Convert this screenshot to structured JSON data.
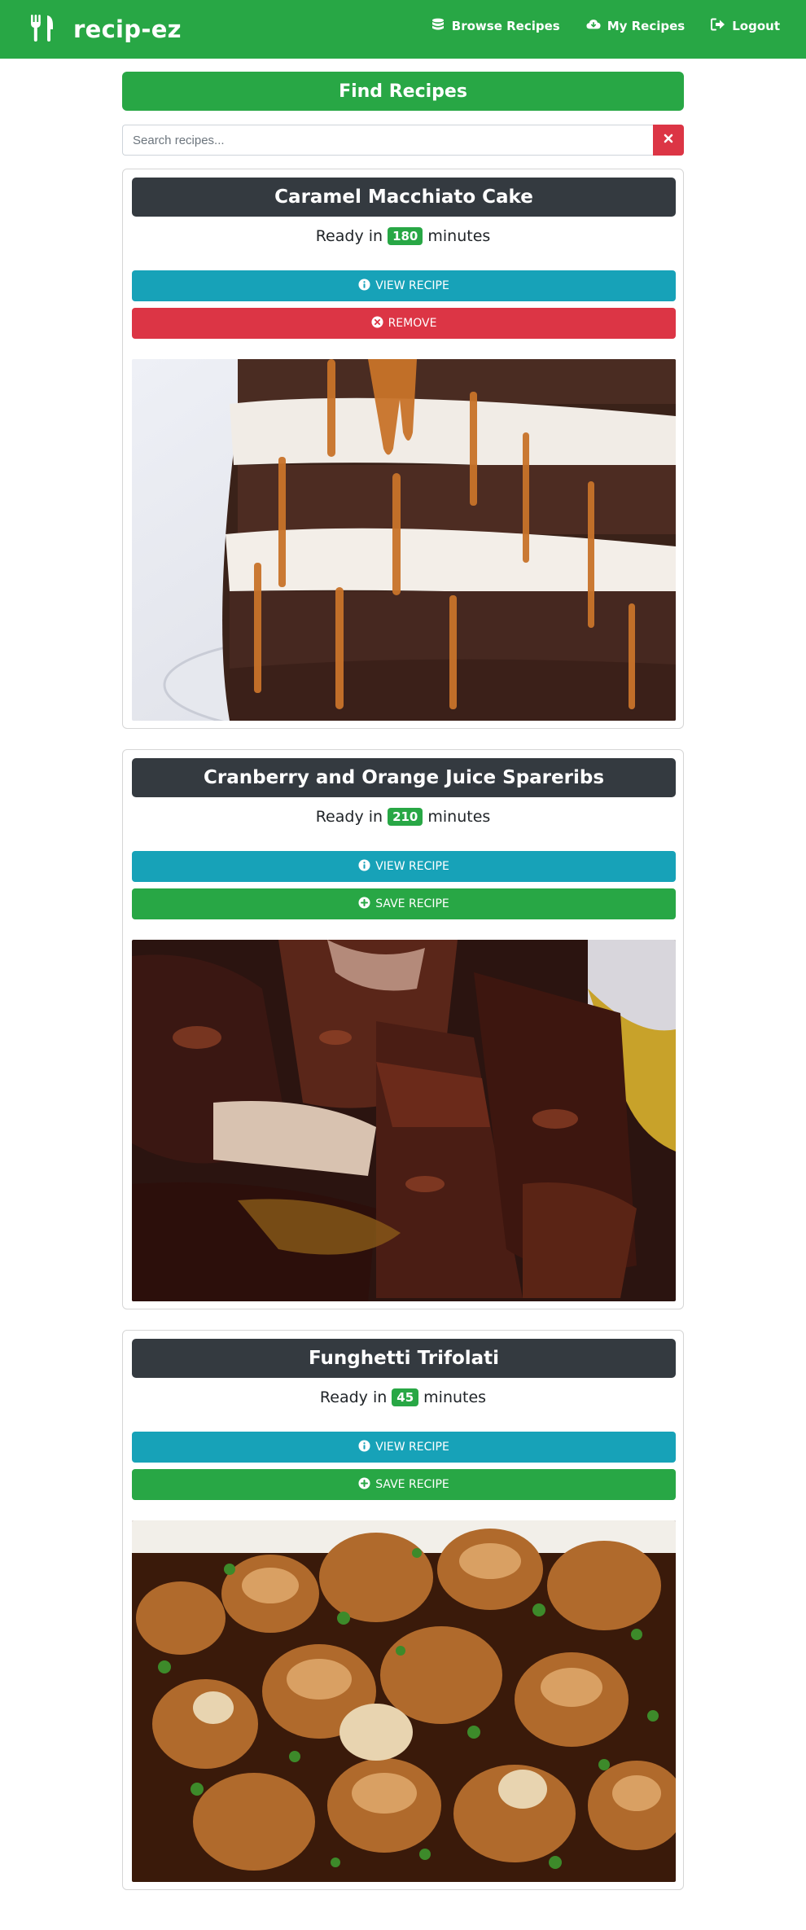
{
  "app": {
    "brand": "recip-ez"
  },
  "nav": {
    "browse": "Browse Recipes",
    "my_recipes": "My Recipes",
    "logout": "Logout"
  },
  "find": {
    "title": "Find Recipes"
  },
  "search": {
    "placeholder": "Search recipes...",
    "value": ""
  },
  "colors": {
    "primary_green": "#28a745",
    "info_teal": "#17a2b8",
    "danger_red": "#dc3545",
    "dark_header": "#343a40"
  },
  "recipes": [
    {
      "title": "Caramel Macchiato Cake",
      "ready_prefix": "Ready in",
      "minutes": "180",
      "ready_suffix": "minutes",
      "view_label": "VIEW RECIPE",
      "action_label": "REMOVE",
      "action_type": "remove",
      "action_icon": "times-circle-icon"
    },
    {
      "title": "Cranberry and Orange Juice Spareribs",
      "ready_prefix": "Ready in",
      "minutes": "210",
      "ready_suffix": "minutes",
      "view_label": "VIEW RECIPE",
      "action_label": "SAVE RECIPE",
      "action_type": "save",
      "action_icon": "plus-circle-icon"
    },
    {
      "title": "Funghetti Trifolati",
      "ready_prefix": "Ready in",
      "minutes": "45",
      "ready_suffix": "minutes",
      "view_label": "VIEW RECIPE",
      "action_label": "SAVE RECIPE",
      "action_type": "save",
      "action_icon": "plus-circle-icon"
    }
  ]
}
